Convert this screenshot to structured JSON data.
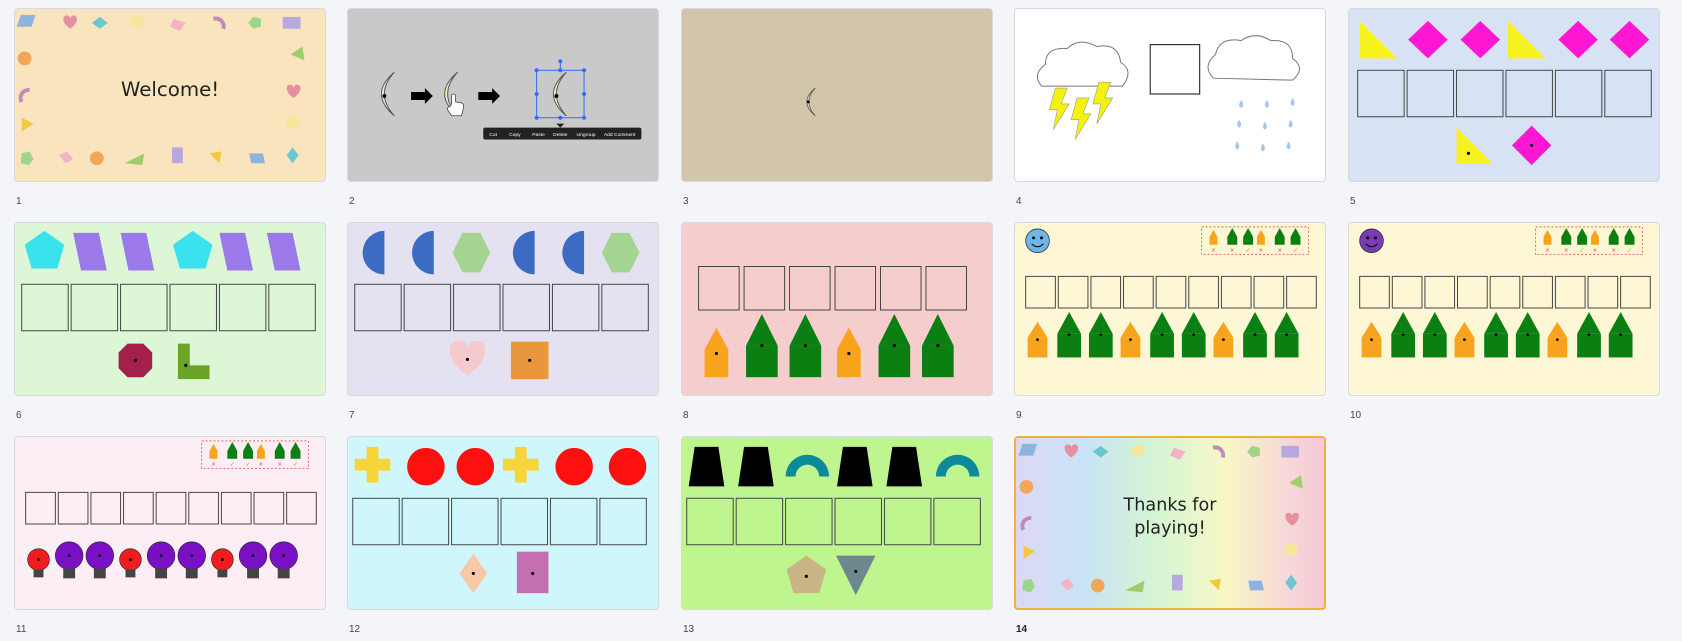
{
  "slides": [
    {
      "number": "1",
      "title": "Welcome!"
    },
    {
      "number": "2",
      "context_menu": [
        "Cut",
        "Copy",
        "Paste",
        "Delete",
        "Ungroup",
        "Add Comment"
      ]
    },
    {
      "number": "3"
    },
    {
      "number": "4"
    },
    {
      "number": "5"
    },
    {
      "number": "6"
    },
    {
      "number": "7"
    },
    {
      "number": "8"
    },
    {
      "number": "9",
      "marks": [
        "×",
        "×",
        "✓",
        "×",
        "×",
        "✓"
      ]
    },
    {
      "number": "10",
      "marks": [
        "×",
        "×",
        "✓",
        "×",
        "×",
        "✓"
      ]
    },
    {
      "number": "11",
      "marks": [
        "×",
        "✓",
        "✓",
        "×",
        "×",
        "✓"
      ]
    },
    {
      "number": "12"
    },
    {
      "number": "13"
    },
    {
      "number": "14",
      "title_line1": "Thanks for",
      "title_line2": "playing!"
    }
  ],
  "selected_slide": "14",
  "colors": {
    "accent": "#f0b13a",
    "selection_blue": "#2f6bff"
  }
}
